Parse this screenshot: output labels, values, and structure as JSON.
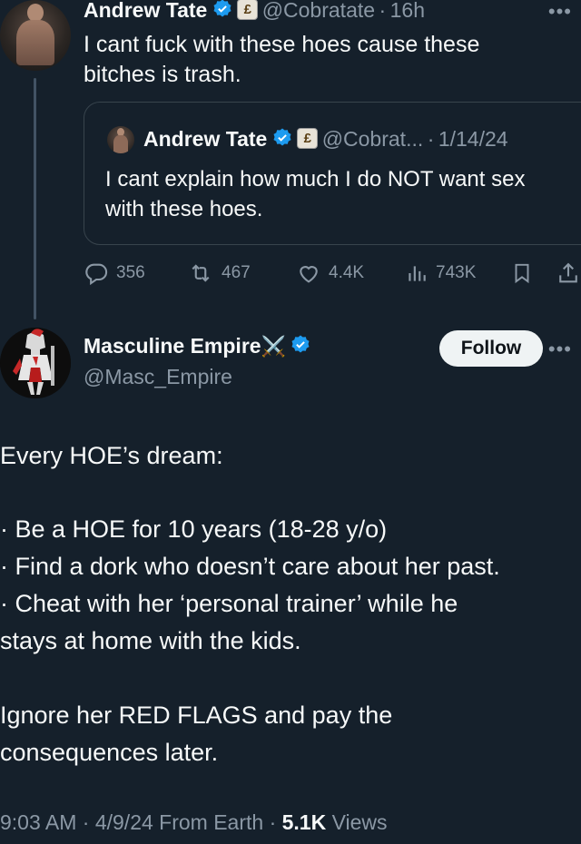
{
  "reply": {
    "name": "Andrew Tate",
    "handle": "@Cobratate",
    "time": "16h",
    "text_line1": "I cant fuck with these hoes cause these",
    "text_line2": "bitches is trash.",
    "badge_letter": "£"
  },
  "quote": {
    "name": "Andrew Tate",
    "handle": "@Cobrat...",
    "date": "1/14/24",
    "text_line1": "I cant explain how much I do NOT want sex",
    "text_line2": "with these hoes."
  },
  "actions": {
    "replies": "356",
    "reposts": "467",
    "likes": "4.4K",
    "views": "743K"
  },
  "main": {
    "name": "Masculine Empire",
    "name_suffix": "⚔️",
    "handle": "@Masc_Empire",
    "follow_label": "Follow",
    "lines": [
      "Every HOE’s dream:",
      "· Be a HOE for 10 years (18-28 y/o)",
      "· Find a dork who doesn’t care about her past.",
      "· Cheat with her ‘personal trainer’ while he",
      "stays at home with the kids.",
      "Ignore her RED FLAGS and pay the",
      "consequences later."
    ],
    "footer_time": "9:03 AM · 4/9/24 From Earth · ",
    "footer_views_count": "5.1K",
    "footer_views_label": " Views"
  },
  "colors": {
    "background": "#15202b",
    "verified": "#1d9bf0",
    "muted": "#8b98a5"
  }
}
